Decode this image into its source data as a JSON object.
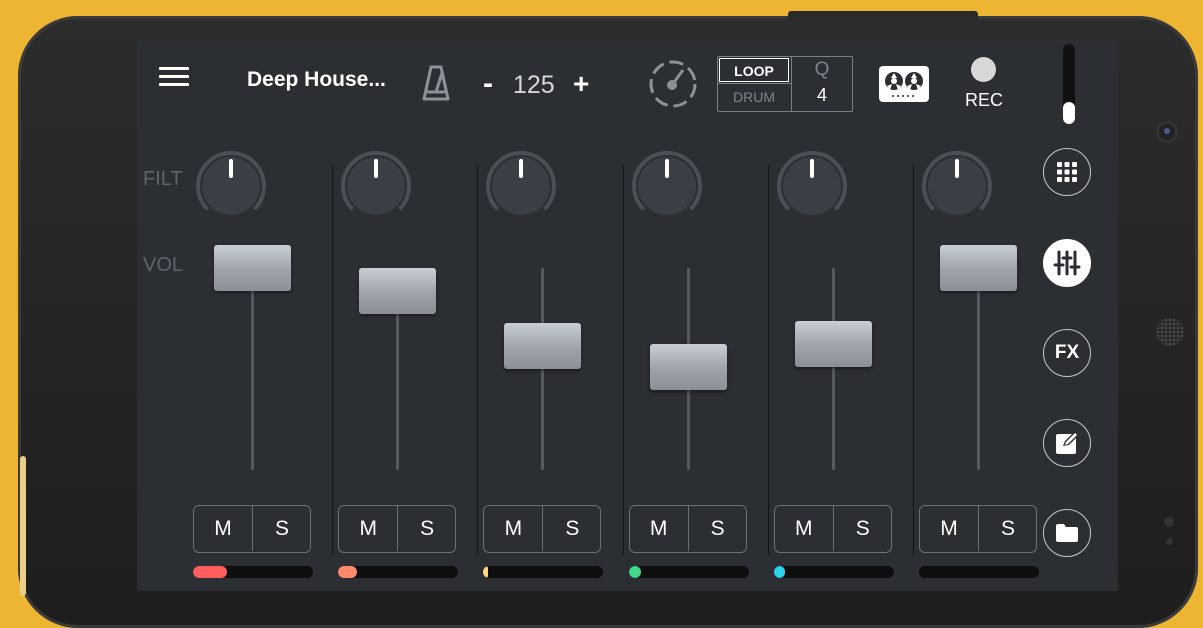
{
  "project": {
    "title": "Deep House..."
  },
  "tempo": {
    "minus": "-",
    "bpm": "125",
    "plus": "+"
  },
  "mode": {
    "loop": "LOOP",
    "drum": "DRUM",
    "quantize_label": "Q",
    "quantize_value": "4"
  },
  "record": {
    "label": "REC"
  },
  "master_volume": {
    "level_fraction": 0.28
  },
  "row_labels": {
    "filter": "FILT",
    "volume": "VOL"
  },
  "channels": [
    {
      "filter_pct": 50,
      "volume_pct": 100,
      "mute": "M",
      "solo": "S",
      "level_pct": 28,
      "color": "#ff5e5e"
    },
    {
      "filter_pct": 50,
      "volume_pct": 86,
      "mute": "M",
      "solo": "S",
      "level_pct": 16,
      "color": "#ff8a6b"
    },
    {
      "filter_pct": 50,
      "volume_pct": 53,
      "mute": "M",
      "solo": "S",
      "level_pct": 4,
      "color": "#ffd77a"
    },
    {
      "filter_pct": 50,
      "volume_pct": 40,
      "mute": "M",
      "solo": "S",
      "level_pct": 10,
      "color": "#43d98c"
    },
    {
      "filter_pct": 50,
      "volume_pct": 54,
      "mute": "M",
      "solo": "S",
      "level_pct": 9,
      "color": "#2ad4ea"
    },
    {
      "filter_pct": 50,
      "volume_pct": 100,
      "mute": "M",
      "solo": "S",
      "level_pct": 0,
      "color": "#ffffff"
    }
  ],
  "side_nav": {
    "items": [
      "pads-icon",
      "mixer-icon",
      "fx-icon",
      "edit-icon",
      "folder-icon"
    ],
    "fx_label": "FX",
    "active": "mixer-icon"
  },
  "colors": {
    "background": "#edb531",
    "screen": "#2b2e33",
    "knob_arc": "#4a4f56"
  }
}
